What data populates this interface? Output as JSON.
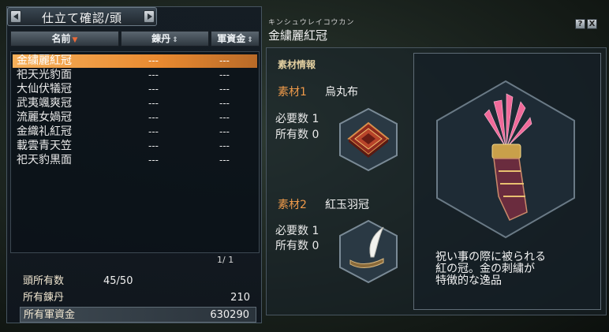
{
  "title_bar": {
    "title": "仕立て確認/頭"
  },
  "columns": {
    "name": "名前",
    "ren": "錬丹",
    "gun": "軍資金"
  },
  "list": [
    {
      "name": "金繍麗紅冠",
      "ren": "---",
      "gun": "---",
      "selected": true
    },
    {
      "name": "祀天光豹面",
      "ren": "---",
      "gun": "---"
    },
    {
      "name": "大仙伏犠冠",
      "ren": "---",
      "gun": "---"
    },
    {
      "name": "武夷颯爽冠",
      "ren": "---",
      "gun": "---"
    },
    {
      "name": "流麗女媧冠",
      "ren": "---",
      "gun": "---"
    },
    {
      "name": "金織礼紅冠",
      "ren": "---",
      "gun": "---"
    },
    {
      "name": "載雲青天笠",
      "ren": "---",
      "gun": "---"
    },
    {
      "name": "祀天豹黒面",
      "ren": "---",
      "gun": "---"
    }
  ],
  "page_indicator": "1/ 1",
  "stats": {
    "heads_label": "頭所有数",
    "heads_value": "45/50",
    "ren_label": "所有錬丹",
    "ren_value": "210",
    "gun_label": "所有軍資金",
    "gun_value": "630290"
  },
  "item": {
    "reading": "キンシュウレイコウカン",
    "name": "金繍麗紅冠"
  },
  "materials": {
    "header": "素材情報",
    "m1": {
      "label": "素材1",
      "name": "烏丸布",
      "req_label": "必要数",
      "req": "1",
      "own_label": "所有数",
      "own": "0"
    },
    "m2": {
      "label": "素材2",
      "name": "紅玉羽冠",
      "req_label": "必要数",
      "req": "1",
      "own_label": "所有数",
      "own": "0"
    }
  },
  "description": "祝い事の際に被られる\n紅の冠。金の刺繍が\n特徴的な逸品",
  "buttons": {
    "help": "?",
    "close": "X"
  },
  "colors": {
    "selection": "#f0a04a",
    "material_label": "#ef9a4a",
    "panel_border": "#5f6c76"
  },
  "icons": [
    "arrow-left-icon",
    "arrow-right-icon",
    "sort-desc-icon",
    "sort-icon",
    "help-icon",
    "close-icon",
    "carpet-icon",
    "feather-crown-icon",
    "red-feather-crown-icon"
  ]
}
